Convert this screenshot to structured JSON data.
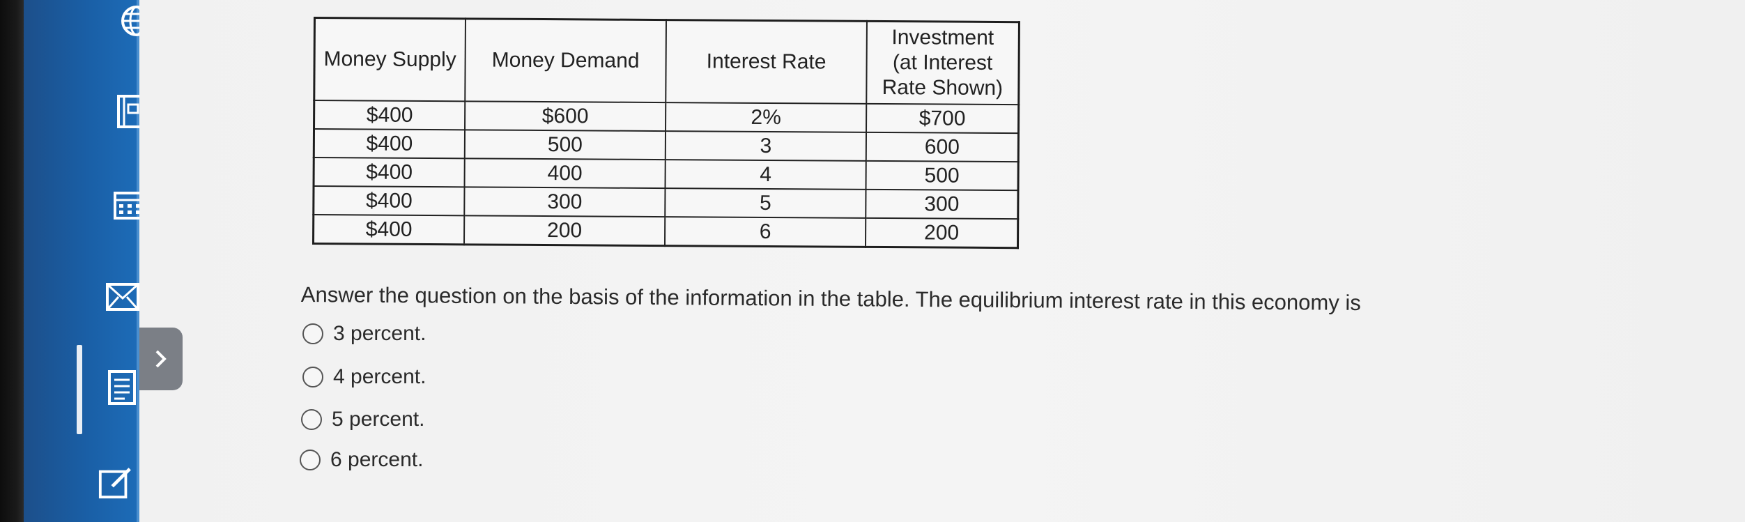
{
  "table": {
    "headers": [
      "Money Supply",
      "Money Demand",
      "Interest Rate",
      "Investment\n(at Interest\nRate Shown)"
    ],
    "rows": [
      [
        "$400",
        "$600",
        "2%",
        "$700"
      ],
      [
        "$400",
        "500",
        "3",
        "600"
      ],
      [
        "$400",
        "400",
        "4",
        "500"
      ],
      [
        "$400",
        "300",
        "5",
        "300"
      ],
      [
        "$400",
        "200",
        "6",
        "200"
      ]
    ]
  },
  "question": {
    "text": "Answer the question on the basis of the information in the table. The equilibrium interest rate in this economy is",
    "options": [
      "3 percent.",
      "4 percent.",
      "5 percent.",
      "6 percent."
    ]
  },
  "sidebar": {
    "icons": [
      "globe-icon",
      "book-icon",
      "calendar-icon",
      "mail-icon",
      "notes-icon",
      "edit-icon"
    ]
  },
  "colors": {
    "sidebar": "#1a5fa6",
    "sidebar_strip": "#4a8fcf",
    "collapse_tab": "#7b7f86"
  }
}
